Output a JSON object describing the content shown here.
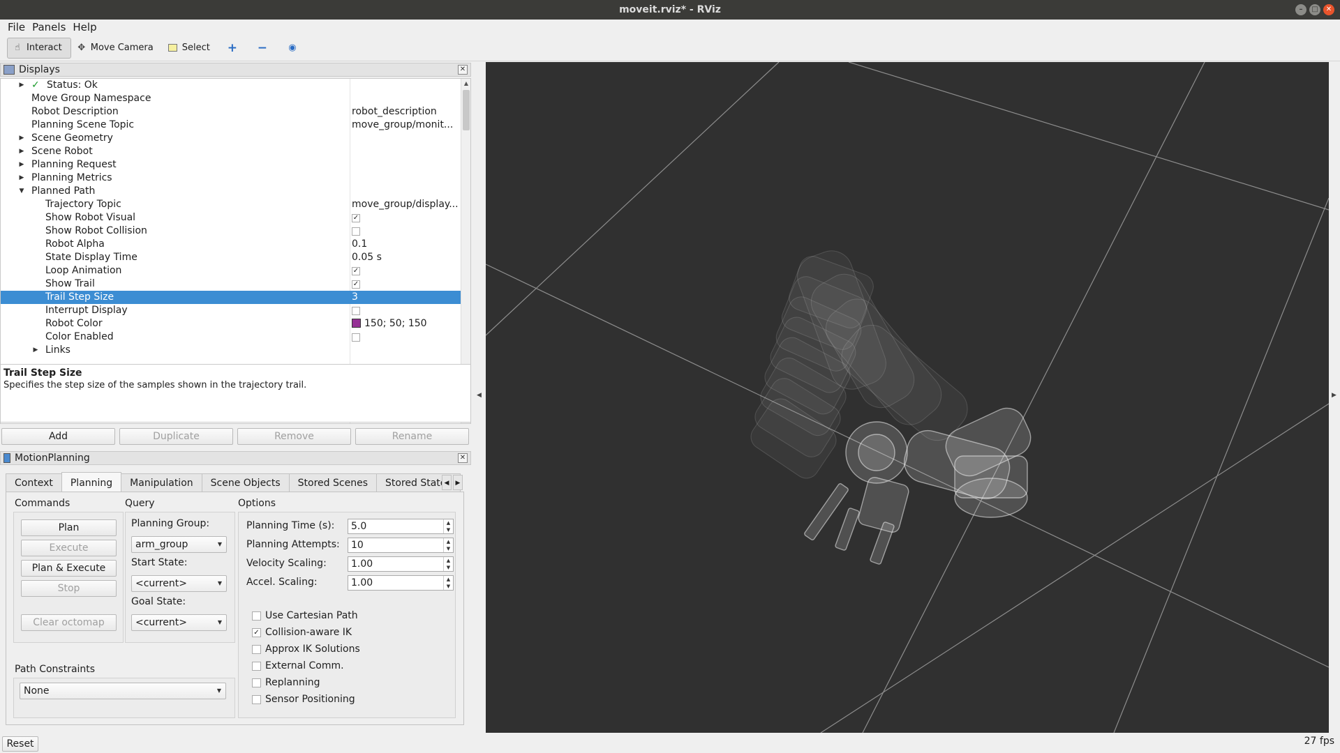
{
  "window": {
    "title": "moveit.rviz* - RViz"
  },
  "menu": {
    "file": "File",
    "panels": "Panels",
    "help": "Help"
  },
  "toolbar": {
    "interact": "Interact",
    "move_camera": "Move Camera",
    "select": "Select"
  },
  "displays": {
    "title": "Displays",
    "rows": [
      {
        "label": "Status: Ok",
        "value": ""
      },
      {
        "label": "Move Group Namespace",
        "value": ""
      },
      {
        "label": "Robot Description",
        "value": "robot_description"
      },
      {
        "label": "Planning Scene Topic",
        "value": "move_group/monit..."
      },
      {
        "label": "Scene Geometry",
        "value": ""
      },
      {
        "label": "Scene Robot",
        "value": ""
      },
      {
        "label": "Planning Request",
        "value": ""
      },
      {
        "label": "Planning Metrics",
        "value": ""
      },
      {
        "label": "Planned Path",
        "value": ""
      },
      {
        "label": "Trajectory Topic",
        "value": "move_group/display..."
      },
      {
        "label": "Show Robot Visual",
        "value": "✓"
      },
      {
        "label": "Show Robot Collision",
        "value": ""
      },
      {
        "label": "Robot Alpha",
        "value": "0.1"
      },
      {
        "label": "State Display Time",
        "value": "0.05 s"
      },
      {
        "label": "Loop Animation",
        "value": "✓"
      },
      {
        "label": "Show Trail",
        "value": "✓"
      },
      {
        "label": "Trail Step Size",
        "value": "3"
      },
      {
        "label": "Interrupt Display",
        "value": ""
      },
      {
        "label": "Robot Color",
        "value": "150; 50; 150"
      },
      {
        "label": "Color Enabled",
        "value": ""
      },
      {
        "label": "Links",
        "value": ""
      }
    ],
    "robot_color_hex": "#963296",
    "selection_color": "#3c8dd3",
    "description_title": "Trail Step Size",
    "description_text": "Specifies the step size of the samples shown in the trajectory trail.",
    "buttons": {
      "add": "Add",
      "duplicate": "Duplicate",
      "remove": "Remove",
      "rename": "Rename"
    }
  },
  "motion_planning": {
    "title": "MotionPlanning",
    "tabs": [
      "Context",
      "Planning",
      "Manipulation",
      "Scene Objects",
      "Stored Scenes",
      "Stored States"
    ],
    "active_tab": "Planning",
    "commands": {
      "title": "Commands",
      "plan": "Plan",
      "execute": "Execute",
      "plan_execute": "Plan & Execute",
      "stop": "Stop",
      "clear_octomap": "Clear octomap"
    },
    "query": {
      "title": "Query",
      "planning_group_label": "Planning Group:",
      "planning_group": "arm_group",
      "start_state_label": "Start State:",
      "start_state": "<current>",
      "goal_state_label": "Goal State:",
      "goal_state": "<current>"
    },
    "options": {
      "title": "Options",
      "planning_time_label": "Planning Time (s):",
      "planning_time": "5.0",
      "planning_attempts_label": "Planning Attempts:",
      "planning_attempts": "10",
      "velocity_scaling_label": "Velocity Scaling:",
      "velocity_scaling": "1.00",
      "accel_scaling_label": "Accel. Scaling:",
      "accel_scaling": "1.00",
      "use_cartesian_path": "Use Cartesian Path",
      "collision_aware_ik": "Collision-aware IK",
      "approx_ik": "Approx IK Solutions",
      "external_comm": "External Comm.",
      "replanning": "Replanning",
      "sensor_positioning": "Sensor Positioning"
    },
    "path_constraints": {
      "title": "Path Constraints",
      "value": "None"
    }
  },
  "status": {
    "reset": "Reset",
    "fps": "27 fps"
  }
}
